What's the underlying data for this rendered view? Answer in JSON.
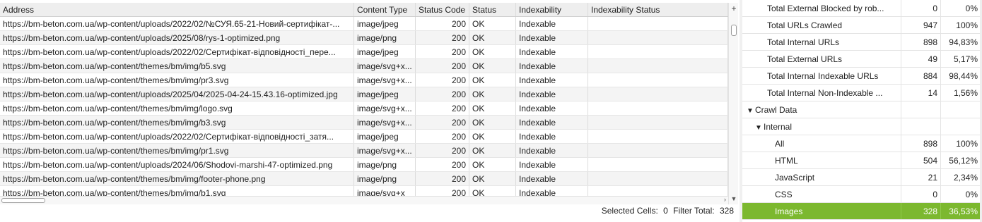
{
  "table": {
    "columns": [
      "Address",
      "Content Type",
      "Status Code",
      "Status",
      "Indexability",
      "Indexability Status"
    ],
    "rows": [
      {
        "address": "https://bm-beton.com.ua/wp-content/uploads/2022/02/№СУЯ.65-21-Новий-сертифікат-...",
        "type": "image/jpeg",
        "code": "200",
        "status": "OK",
        "indexability": "Indexable",
        "index_status": ""
      },
      {
        "address": "https://bm-beton.com.ua/wp-content/uploads/2025/08/rys-1-optimized.png",
        "type": "image/png",
        "code": "200",
        "status": "OK",
        "indexability": "Indexable",
        "index_status": ""
      },
      {
        "address": "https://bm-beton.com.ua/wp-content/uploads/2022/02/Сертифікат-відповідності_пере...",
        "type": "image/jpeg",
        "code": "200",
        "status": "OK",
        "indexability": "Indexable",
        "index_status": ""
      },
      {
        "address": "https://bm-beton.com.ua/wp-content/themes/bm/img/b5.svg",
        "type": "image/svg+x...",
        "code": "200",
        "status": "OK",
        "indexability": "Indexable",
        "index_status": ""
      },
      {
        "address": "https://bm-beton.com.ua/wp-content/themes/bm/img/pr3.svg",
        "type": "image/svg+x...",
        "code": "200",
        "status": "OK",
        "indexability": "Indexable",
        "index_status": ""
      },
      {
        "address": "https://bm-beton.com.ua/wp-content/uploads/2025/04/2025-04-24-15.43.16-optimized.jpg",
        "type": "image/jpeg",
        "code": "200",
        "status": "OK",
        "indexability": "Indexable",
        "index_status": ""
      },
      {
        "address": "https://bm-beton.com.ua/wp-content/themes/bm/img/logo.svg",
        "type": "image/svg+x...",
        "code": "200",
        "status": "OK",
        "indexability": "Indexable",
        "index_status": ""
      },
      {
        "address": "https://bm-beton.com.ua/wp-content/themes/bm/img/b3.svg",
        "type": "image/svg+x...",
        "code": "200",
        "status": "OK",
        "indexability": "Indexable",
        "index_status": ""
      },
      {
        "address": "https://bm-beton.com.ua/wp-content/uploads/2022/02/Сертифікат-відповідності_затя...",
        "type": "image/jpeg",
        "code": "200",
        "status": "OK",
        "indexability": "Indexable",
        "index_status": ""
      },
      {
        "address": "https://bm-beton.com.ua/wp-content/themes/bm/img/pr1.svg",
        "type": "image/svg+x...",
        "code": "200",
        "status": "OK",
        "indexability": "Indexable",
        "index_status": ""
      },
      {
        "address": "https://bm-beton.com.ua/wp-content/uploads/2024/06/Shodovi-marshi-47-optimized.png",
        "type": "image/png",
        "code": "200",
        "status": "OK",
        "indexability": "Indexable",
        "index_status": ""
      },
      {
        "address": "https://bm-beton.com.ua/wp-content/themes/bm/img/footer-phone.png",
        "type": "image/png",
        "code": "200",
        "status": "OK",
        "indexability": "Indexable",
        "index_status": ""
      },
      {
        "address": "https://bm-beton.com.ua/wp-content/themes/bm/img/b1.svg",
        "type": "image/svg+x",
        "code": "200",
        "status": "OK",
        "indexability": "Indexable",
        "index_status": ""
      }
    ],
    "add_column_label": "+"
  },
  "status_bar": {
    "selected_cells_label": "Selected Cells:",
    "selected_cells_value": "0",
    "filter_total_label": "Filter Total:",
    "filter_total_value": "328"
  },
  "overview": {
    "rows": [
      {
        "label": "Total External Blocked by rob...",
        "count": "0",
        "percent": "0%",
        "level": 0,
        "icon": ""
      },
      {
        "label": "Total URLs Crawled",
        "count": "947",
        "percent": "100%",
        "level": 0,
        "icon": ""
      },
      {
        "label": "Total Internal URLs",
        "count": "898",
        "percent": "94,83%",
        "level": 0,
        "icon": ""
      },
      {
        "label": "Total External URLs",
        "count": "49",
        "percent": "5,17%",
        "level": 0,
        "icon": ""
      },
      {
        "label": "Total Internal Indexable URLs",
        "count": "884",
        "percent": "98,44%",
        "level": 0,
        "icon": ""
      },
      {
        "label": "Total Internal Non-Indexable ...",
        "count": "14",
        "percent": "1,56%",
        "level": 0,
        "icon": ""
      },
      {
        "label": "Crawl Data",
        "count": "",
        "percent": "",
        "level": -1,
        "icon": "expanded-triangle-icon"
      },
      {
        "label": "Internal",
        "count": "",
        "percent": "",
        "level": 1,
        "icon": "expanded-triangle-icon"
      },
      {
        "label": "All",
        "count": "898",
        "percent": "100%",
        "level": 2,
        "icon": ""
      },
      {
        "label": "HTML",
        "count": "504",
        "percent": "56,12%",
        "level": 2,
        "icon": ""
      },
      {
        "label": "JavaScript",
        "count": "21",
        "percent": "2,34%",
        "level": 2,
        "icon": ""
      },
      {
        "label": "CSS",
        "count": "0",
        "percent": "0%",
        "level": 2,
        "icon": ""
      },
      {
        "label": "Images",
        "count": "328",
        "percent": "36,53%",
        "level": 2,
        "icon": "",
        "selected": true
      }
    ]
  },
  "colors": {
    "selected_row": "#7cb82f",
    "header_bg": "#eeeeee",
    "alt_row_bg": "#f4f4f4"
  }
}
